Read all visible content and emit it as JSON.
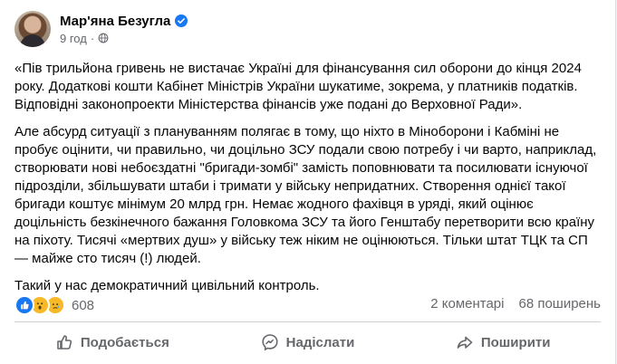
{
  "post": {
    "author": "Мар'яна Безугла",
    "time": "9 год",
    "paragraphs": [
      "«Пів трильйона гривень не вистачає Україні для фінансування сил оборони до кінця 2024 року. Додаткові кошти Кабінет Міністрів України шукатиме, зокрема, у платників податків. Відповідні законопроекти Міністерства фінансів уже подані до Верховної Ради».",
      "Але абсурд ситуації з плануванням полягає в тому, що ніхто в Міноборони і Кабміні не пробує оцінити, чи правильно, чи доцільно ЗСУ подали свою потребу і чи варто, наприклад, створювати нові небоєздатні \"бригади-зомбі\" замість поповнювати та посилювати існуючої підрозділи, збільшувати штаби і тримати у війську непридатних. Створення однієї такої бригади коштує мінімум 20 млрд грн. Немає жодного фахівця в уряді, який оцінює доцільність безкінечного бажання Головкома ЗСУ та його Генштабу перетворити всю країну на піхоту. Тисячі «мертвих душ» у війську теж ніким не оцінюються. Тільки штат ТЦК та СП — майже сто тисяч (!) людей.",
      "Такий у нас демократичний цивільний контроль."
    ],
    "reactions": {
      "icons": [
        "like-reaction-icon",
        "wow-reaction-icon",
        "sad-reaction-icon"
      ],
      "count": "608"
    },
    "comments": "2 коментарі",
    "shares": "68 поширень"
  },
  "actions": {
    "like": "Подобається",
    "comment": "Надіслати",
    "share": "Поширити"
  },
  "colors": {
    "brand": "#1877f2",
    "text": "#050505",
    "secondary": "#65676b",
    "reaction_yellow": "#f7b928"
  }
}
